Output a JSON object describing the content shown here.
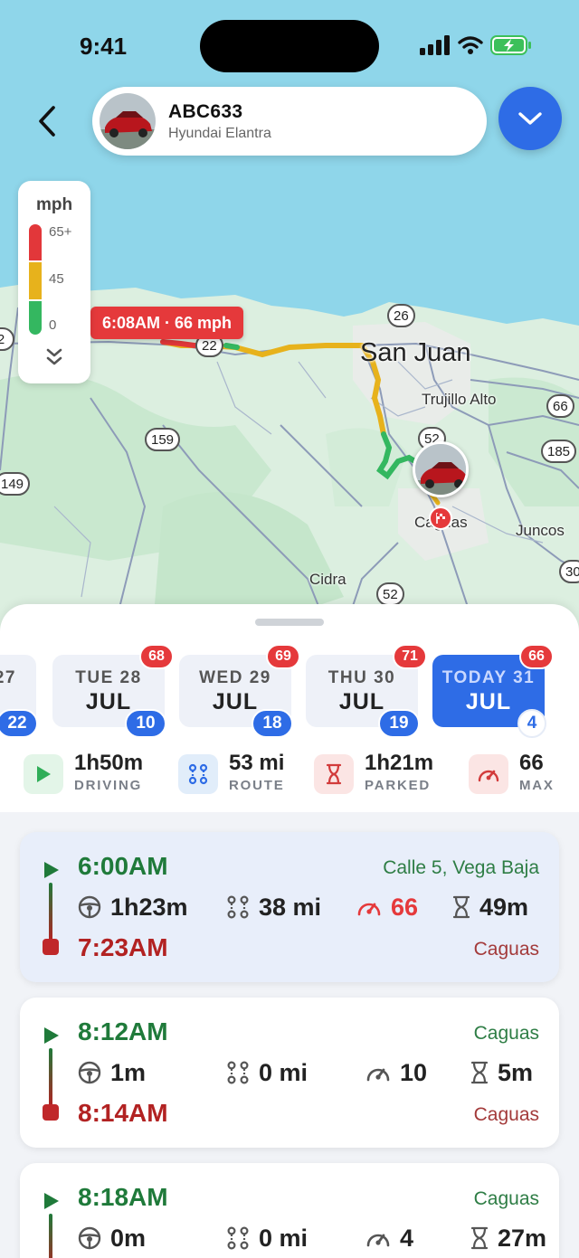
{
  "status_bar": {
    "time": "9:41"
  },
  "vehicle": {
    "plate": "ABC633",
    "model": "Hyundai Elantra"
  },
  "legend": {
    "unit": "mph",
    "ticks": [
      "65+",
      "45",
      "0"
    ]
  },
  "map": {
    "callout": "6:08AM · 66 mph",
    "cities": {
      "big": "San Juan",
      "trujillo": "Trujillo Alto",
      "juncos": "Juncos",
      "cidra": "Cidra",
      "caguas": "Caguas"
    },
    "routes": [
      "22",
      "26",
      "2",
      "159",
      "149",
      "52",
      "66",
      "185",
      "30",
      "52"
    ],
    "route_colors": {
      "fast": "#e2373a",
      "medium": "#e7b21c",
      "slow": "#34b760"
    }
  },
  "days": [
    {
      "dow": "27",
      "mon": "",
      "trips": "22",
      "max": ""
    },
    {
      "dow": "TUE 28",
      "mon": "JUL",
      "trips": "10",
      "max": "68"
    },
    {
      "dow": "WED 29",
      "mon": "JUL",
      "trips": "18",
      "max": "69"
    },
    {
      "dow": "THU 30",
      "mon": "JUL",
      "trips": "19",
      "max": "71"
    },
    {
      "dow": "TODAY 31",
      "mon": "JUL",
      "trips": "4",
      "max": "66"
    }
  ],
  "stats": [
    {
      "value": "1h50m",
      "label": "DRIVING",
      "icon": "play-icon"
    },
    {
      "value": "53 mi",
      "label": "ROUTE",
      "icon": "route-icon"
    },
    {
      "value": "1h21m",
      "label": "PARKED",
      "icon": "hourglass-icon"
    },
    {
      "value": "66",
      "label": "MAX",
      "icon": "speedometer-icon"
    }
  ],
  "trips": [
    {
      "start_time": "6:00AM",
      "end_time": "7:23AM",
      "start_loc": "Calle 5, Vega Baja",
      "end_loc": "Caguas",
      "duration": "1h23m",
      "distance": "38 mi",
      "max_speed": "66",
      "parked": "49m"
    },
    {
      "start_time": "8:12AM",
      "end_time": "8:14AM",
      "start_loc": "Caguas",
      "end_loc": "Caguas",
      "duration": "1m",
      "distance": "0 mi",
      "max_speed": "10",
      "parked": "5m"
    },
    {
      "start_time": "8:18AM",
      "end_time": "",
      "start_loc": "Caguas",
      "end_loc": "",
      "duration": "0m",
      "distance": "0 mi",
      "max_speed": "4",
      "parked": "27m"
    }
  ]
}
